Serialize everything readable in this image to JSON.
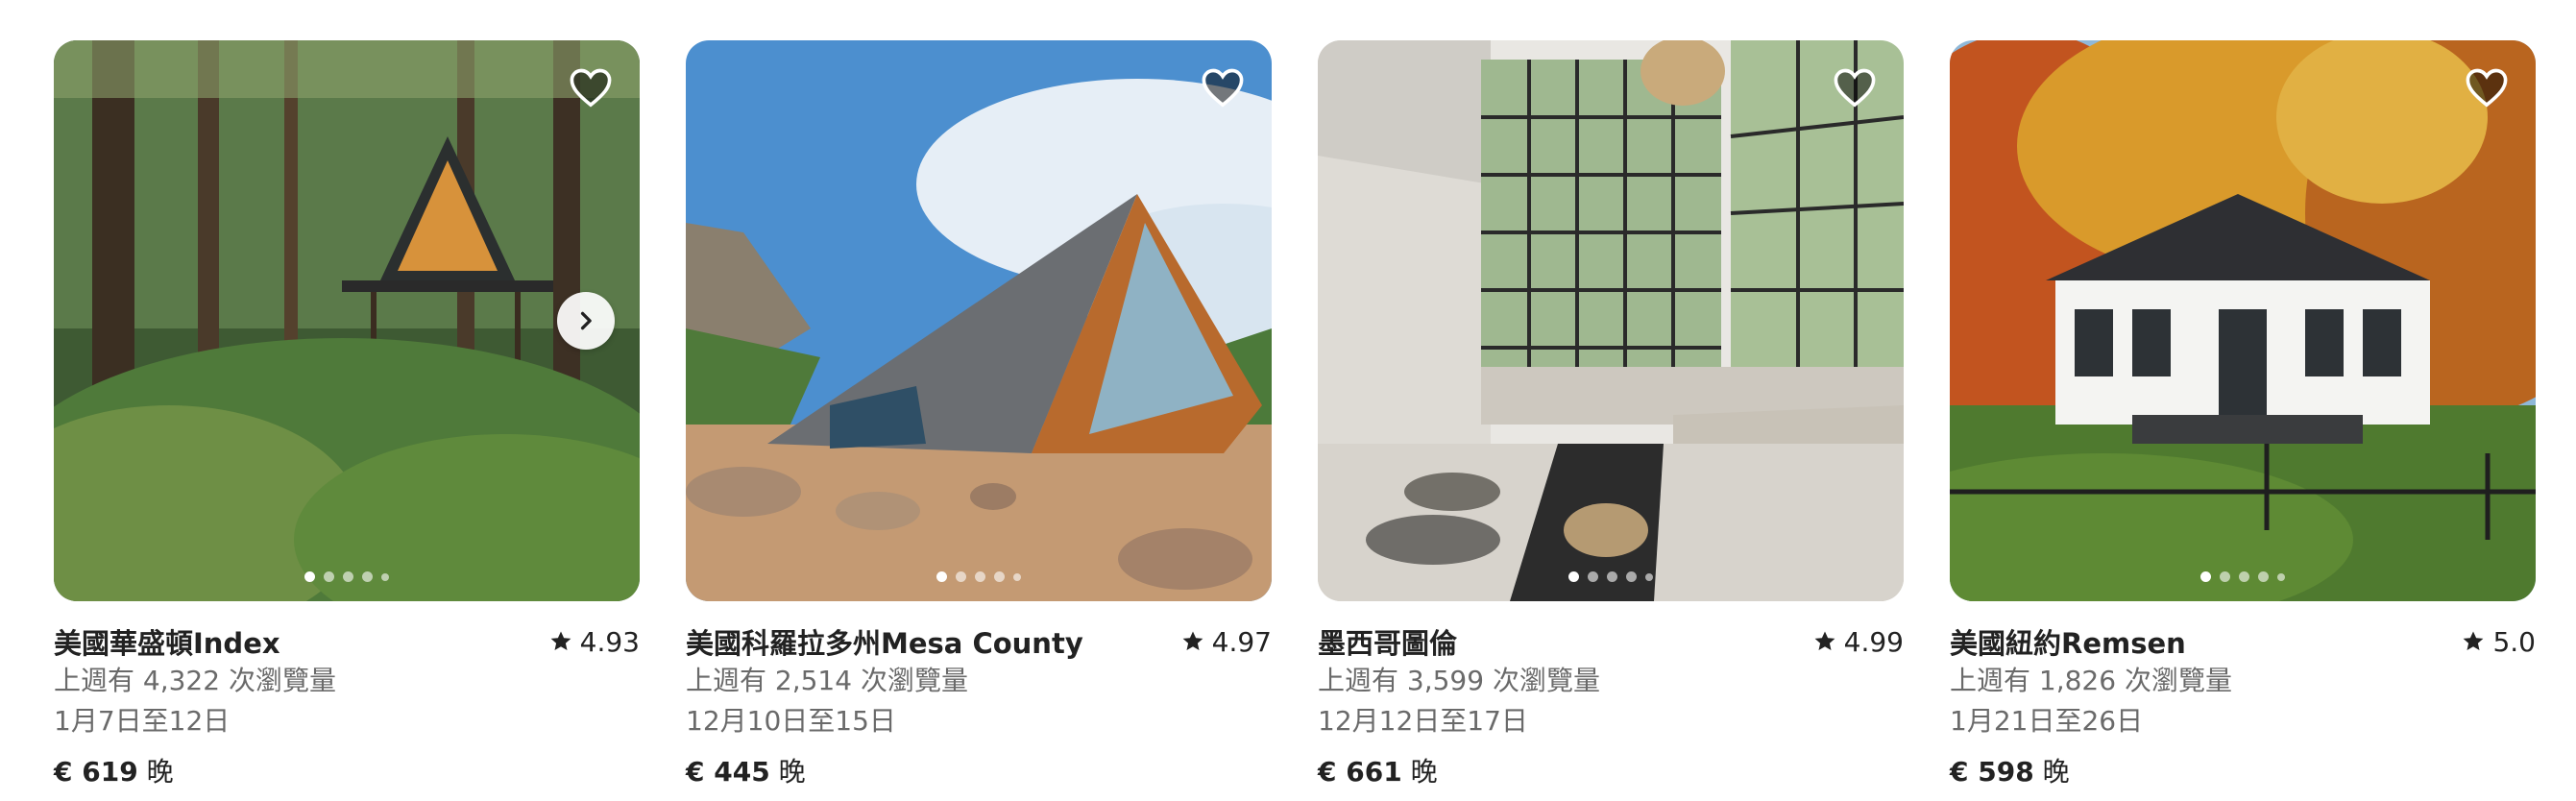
{
  "listings": [
    {
      "title": "美國華盛頓Index",
      "rating": "4.93",
      "views": "上週有 4,322 次瀏覽量",
      "dates": "1月7日至12日",
      "price": "€ 619",
      "price_unit": "晚",
      "photo_count": 5,
      "active_photo": 0
    },
    {
      "title": "美國科羅拉多州Mesa County",
      "rating": "4.97",
      "views": "上週有 2,514 次瀏覽量",
      "dates": "12月10日至15日",
      "price": "€ 445",
      "price_unit": "晚",
      "photo_count": 5,
      "active_photo": 0
    },
    {
      "title": "墨西哥圖倫",
      "rating": "4.99",
      "views": "上週有 3,599 次瀏覽量",
      "dates": "12月12日至17日",
      "price": "€ 661",
      "price_unit": "晚",
      "photo_count": 5,
      "active_photo": 0
    },
    {
      "title": "美國紐約Remsen",
      "rating": "5.0",
      "views": "上週有 1,826 次瀏覽量",
      "dates": "1月21日至26日",
      "price": "€ 598",
      "price_unit": "晚",
      "photo_count": 5,
      "active_photo": 0
    }
  ],
  "icons": {
    "favorite": "heart-outline-icon",
    "rating": "star-icon",
    "next": "chevron-right-icon"
  },
  "colors": {
    "text_primary": "#222222",
    "text_secondary": "#6a6a6a"
  }
}
